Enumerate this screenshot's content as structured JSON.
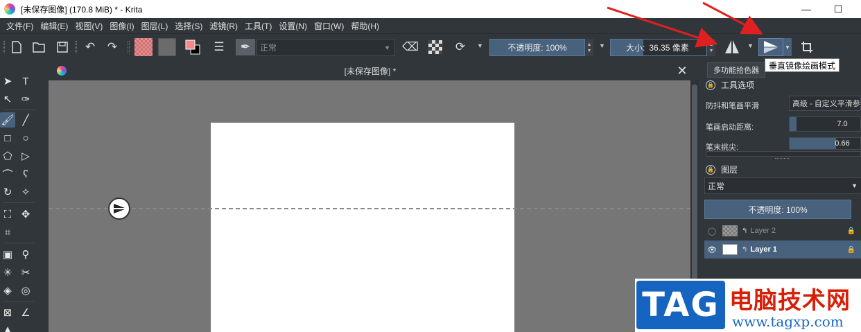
{
  "window": {
    "title": "[未保存图像]  (170.8 MiB)  * - Krita",
    "minimize": "—",
    "maximize": "☐"
  },
  "menu": [
    "文件(F)",
    "编辑(E)",
    "视图(V)",
    "图像(I)",
    "图层(L)",
    "选择(S)",
    "滤镜(R)",
    "工具(T)",
    "设置(N)",
    "窗口(W)",
    "帮助(H)"
  ],
  "toolbar": {
    "blend_mode": "正常",
    "opacity": "不透明度:  100%",
    "size_label": "大小:",
    "size_value": "36.35 像素",
    "tooltip": "垂直镜像绘画模式"
  },
  "document": {
    "tab_title": "[未保存图像]  *",
    "close": "✕"
  },
  "dock": {
    "tab": "多功能拾色器",
    "tool_options_title": "工具选项",
    "smoothing_label": "防抖和笔画平滑",
    "smoothing_value": "高级 - 自定义平滑参数",
    "start_distance_label": "笔画启动距离:",
    "start_distance_value": "7.0",
    "start_distance_fill": 0.1,
    "tail_label": "笔末挑尖:",
    "tail_value": "0.66",
    "tail_fill": 0.66,
    "layers_title": "图层",
    "layer_blend": "正常",
    "layer_opacity": "不透明度:  100%",
    "layers": [
      {
        "name": "Layer 2",
        "visible": false,
        "selected": false
      },
      {
        "name": "Layer 1",
        "visible": true,
        "selected": true
      }
    ]
  },
  "watermark": {
    "logo": "TAG",
    "name": "电脑技术网",
    "url": "www.tagxp.com"
  },
  "colors": {
    "accent": "#48627d",
    "background": "#31363b",
    "canvas": "#767676",
    "arrow": "#e02020"
  }
}
